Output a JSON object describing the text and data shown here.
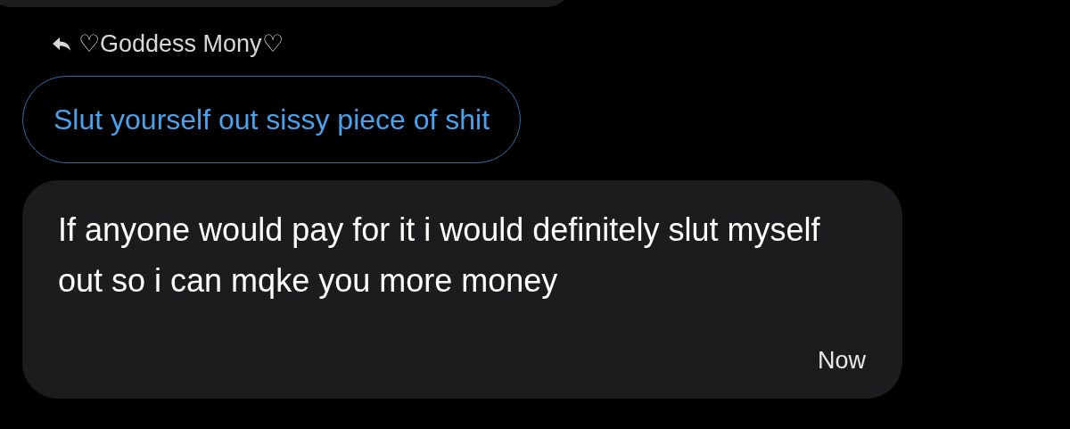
{
  "reply_header": {
    "name": "♡Goddess Mony♡"
  },
  "quoted_message": {
    "text": "Slut yourself out sissy piece of shit"
  },
  "message": {
    "text": "If anyone would pay for it i would definitely slut myself out so i can mqke you more money",
    "time": "Now"
  }
}
